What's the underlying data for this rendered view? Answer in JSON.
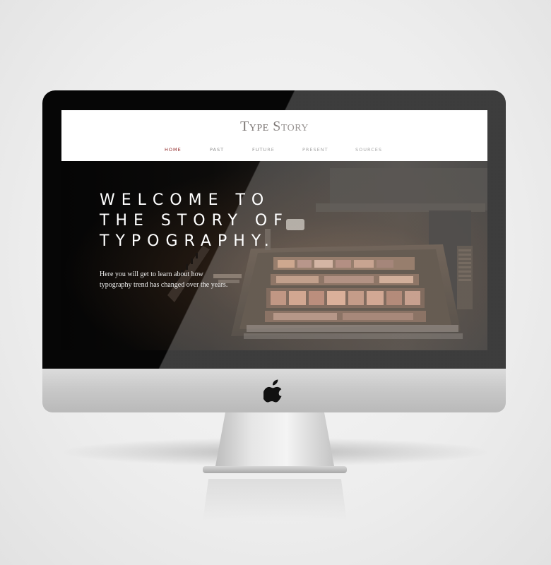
{
  "site": {
    "brand": "Type Story",
    "nav": [
      {
        "label": "HOME",
        "active": true
      },
      {
        "label": "PAST",
        "active": false
      },
      {
        "label": "FUTURE",
        "active": false
      },
      {
        "label": "PRESENT",
        "active": false
      },
      {
        "label": "SOURCES",
        "active": false
      }
    ]
  },
  "hero": {
    "title_lines": [
      "WELCOME TO",
      "THE STORY OF",
      "TYPOGRAPHY."
    ],
    "intro_lines": [
      "Here you will get to learn about how",
      "typography trend has changed over the years."
    ]
  },
  "colors": {
    "nav_active": "#8b1d1d",
    "nav_default": "#8d8d8d",
    "brand_text": "#7a7472",
    "bezel": "#060606"
  },
  "icons": {
    "monitor_logo": "apple-logo-icon"
  }
}
